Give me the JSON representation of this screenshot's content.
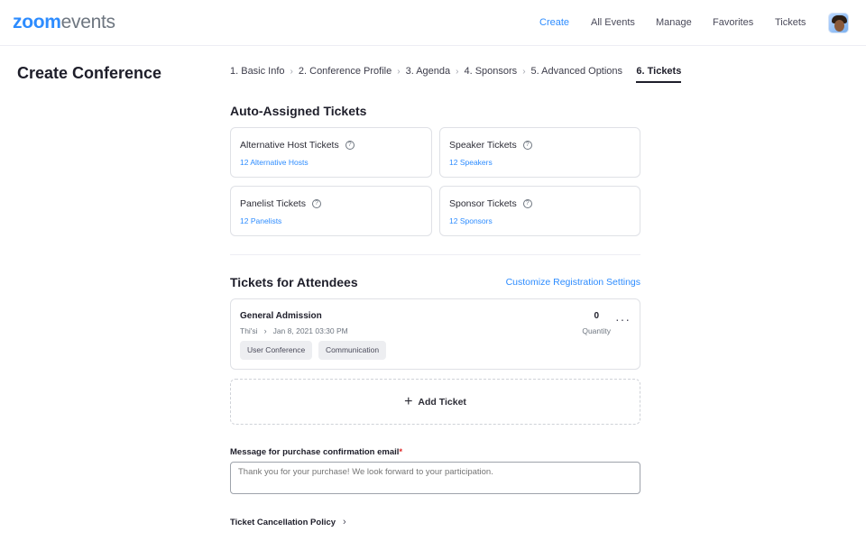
{
  "brand": {
    "logo_bold": "zoom",
    "logo_light": "events",
    "accent": "#2d8cff"
  },
  "nav": {
    "items": [
      {
        "label": "Create",
        "active": true
      },
      {
        "label": "All Events"
      },
      {
        "label": "Manage"
      },
      {
        "label": "Favorites"
      },
      {
        "label": "Tickets"
      }
    ]
  },
  "page": {
    "title": "Create Conference"
  },
  "steps": [
    {
      "label": "1. Basic Info"
    },
    {
      "label": "2. Conference Profile"
    },
    {
      "label": "3. Agenda"
    },
    {
      "label": "4. Sponsors"
    },
    {
      "label": "5. Advanced Options"
    },
    {
      "label": "6. Tickets",
      "active": true
    }
  ],
  "auto_assigned": {
    "title": "Auto-Assigned Tickets",
    "cards": [
      {
        "label": "Alternative Host Tickets",
        "link": "12 Alternative Hosts",
        "help_icon": "question-circle-icon"
      },
      {
        "label": "Speaker Tickets",
        "link": "12 Speakers",
        "help_icon": "question-circle-icon"
      },
      {
        "label": "Panelist Tickets",
        "link": "12 Panelists",
        "help_icon": "question-circle-icon"
      },
      {
        "label": "Sponsor Tickets",
        "link": "12 Sponsors",
        "help_icon": "question-circle-icon"
      }
    ]
  },
  "attendees": {
    "title": "Tickets for Attendees",
    "customize_link": "Customize Registration Settings",
    "ticket": {
      "name": "General Admission",
      "start": "Thi'si",
      "date": "Jan 8, 2021 03:30 PM",
      "tags": [
        "User Conference",
        "Communication"
      ],
      "quantity": "0",
      "quantity_label": "Quantity",
      "more": "···"
    },
    "add_ticket": {
      "icon": "+",
      "label": "Add Ticket"
    }
  },
  "message": {
    "label": "Message for purchase confirmation email",
    "required_mark": "*",
    "placeholder": "Thank you for your purchase! We look forward to your participation."
  },
  "policy": {
    "label": "Ticket Cancellation Policy"
  }
}
